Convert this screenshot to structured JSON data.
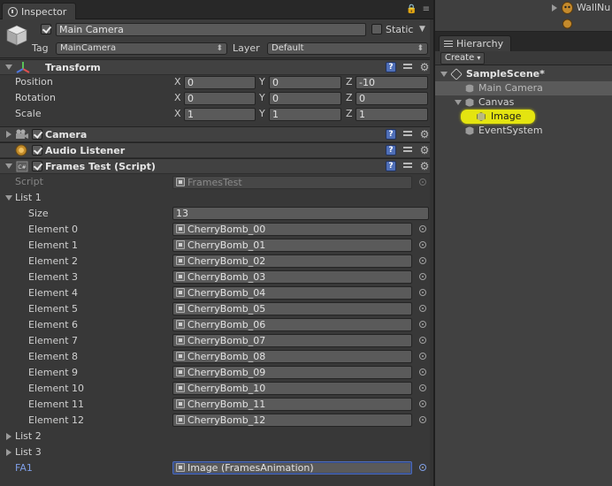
{
  "inspector": {
    "tab_label": "Inspector",
    "object_name": "Main Camera",
    "static_label": "Static",
    "tag_label": "Tag",
    "tag_value": "MainCamera",
    "layer_label": "Layer",
    "layer_value": "Default"
  },
  "transform": {
    "title": "Transform",
    "rows": [
      {
        "label": "Position",
        "x": "0",
        "y": "0",
        "z": "-10"
      },
      {
        "label": "Rotation",
        "x": "0",
        "y": "0",
        "z": "0"
      },
      {
        "label": "Scale",
        "x": "1",
        "y": "1",
        "z": "1"
      }
    ],
    "axis_x": "X",
    "axis_y": "Y",
    "axis_z": "Z"
  },
  "camera": {
    "title": "Camera"
  },
  "audio": {
    "title": "Audio Listener"
  },
  "frames_test": {
    "title": "Frames Test (Script)",
    "script_label": "Script",
    "script_value": "FramesTest",
    "list1_label": "List 1",
    "size_label": "Size",
    "size_value": "13",
    "elements": [
      {
        "label": "Element 0",
        "value": "CherryBomb_00"
      },
      {
        "label": "Element 1",
        "value": "CherryBomb_01"
      },
      {
        "label": "Element 2",
        "value": "CherryBomb_02"
      },
      {
        "label": "Element 3",
        "value": "CherryBomb_03"
      },
      {
        "label": "Element 4",
        "value": "CherryBomb_04"
      },
      {
        "label": "Element 5",
        "value": "CherryBomb_05"
      },
      {
        "label": "Element 6",
        "value": "CherryBomb_06"
      },
      {
        "label": "Element 7",
        "value": "CherryBomb_07"
      },
      {
        "label": "Element 8",
        "value": "CherryBomb_08"
      },
      {
        "label": "Element 9",
        "value": "CherryBomb_09"
      },
      {
        "label": "Element 10",
        "value": "CherryBomb_10"
      },
      {
        "label": "Element 11",
        "value": "CherryBomb_11"
      },
      {
        "label": "Element 12",
        "value": "CherryBomb_12"
      }
    ],
    "list2_label": "List 2",
    "list3_label": "List 3",
    "fa1_label": "FA1",
    "fa1_value": "Image (FramesAnimation)"
  },
  "topright": {
    "item_label": "WallNu"
  },
  "hierarchy": {
    "tab_label": "Hierarchy",
    "create_label": "Create",
    "scene_name": "SampleScene*",
    "items": [
      {
        "label": "Main Camera"
      },
      {
        "label": "Canvas"
      },
      {
        "label": "Image"
      },
      {
        "label": "EventSystem"
      }
    ]
  },
  "colors": {
    "highlight": "#e4e410",
    "selection_blue": "#4f6bb6",
    "panel_bg": "#383838"
  }
}
